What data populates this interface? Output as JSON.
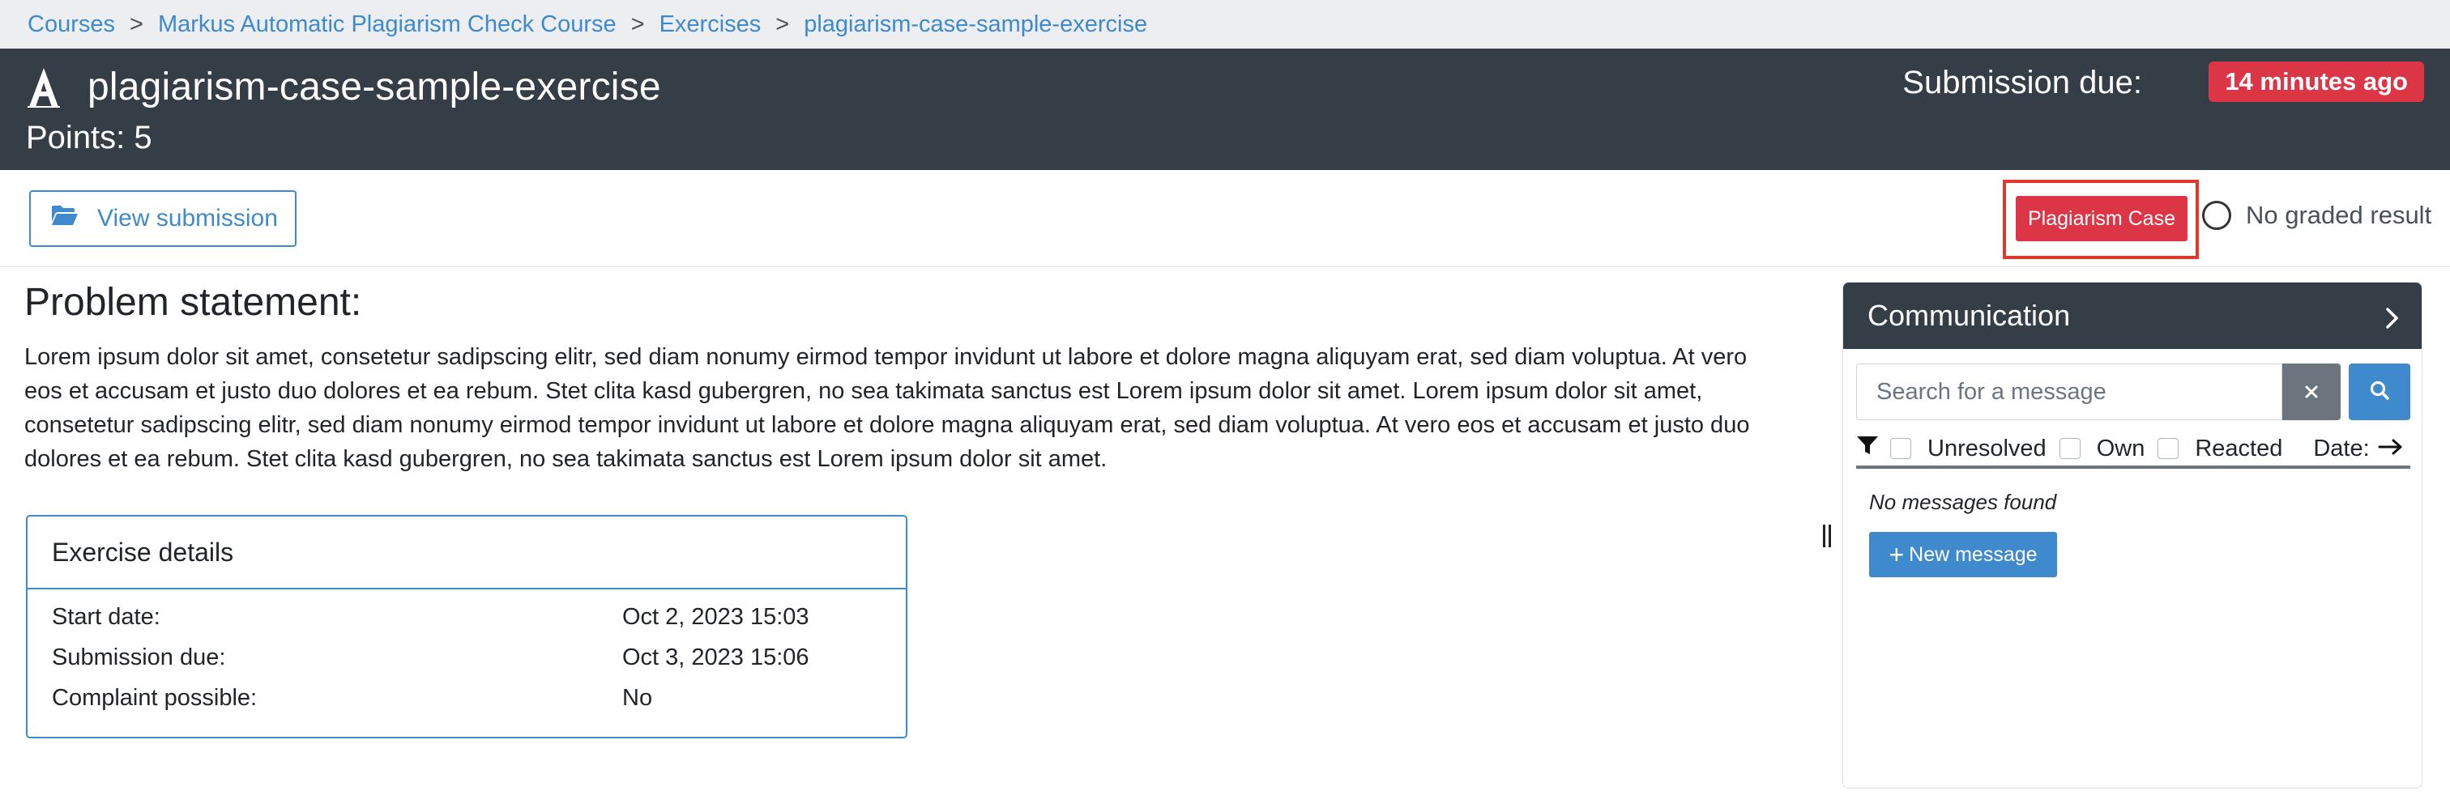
{
  "breadcrumb": {
    "items": [
      "Courses",
      "Markus Automatic Plagiarism Check Course",
      "Exercises",
      "plagiarism-case-sample-exercise"
    ],
    "separator": ">"
  },
  "header": {
    "logo_icon": "artemis-logo-icon",
    "title": "plagiarism-case-sample-exercise",
    "points": "Points: 5",
    "due_label": "Submission due:",
    "due_badge": "14 minutes ago"
  },
  "actions": {
    "view_submission": "View submission",
    "view_submission_icon": "folder-open-icon",
    "plagiarism_case": "Plagiarism Case",
    "graded_status": "No graded result"
  },
  "problem": {
    "title": "Problem statement:",
    "text": "Lorem ipsum dolor sit amet, consetetur sadipscing elitr, sed diam nonumy eirmod tempor invidunt ut labore et dolore magna aliquyam erat, sed diam voluptua. At vero eos et accusam et justo duo dolores et ea rebum. Stet clita kasd gubergren, no sea takimata sanctus est Lorem ipsum dolor sit amet. Lorem ipsum dolor sit amet, consetetur sadipscing elitr, sed diam nonumy eirmod tempor invidunt ut labore et dolore magna aliquyam erat, sed diam voluptua. At vero eos et accusam et justo duo dolores et ea rebum. Stet clita kasd gubergren, no sea takimata sanctus est Lorem ipsum dolor sit amet."
  },
  "details": {
    "title": "Exercise details",
    "rows": [
      {
        "label": "Start date:",
        "value": "Oct 2, 2023 15:03"
      },
      {
        "label": "Submission due:",
        "value": "Oct 3, 2023 15:06"
      },
      {
        "label": "Complaint possible:",
        "value": "No"
      }
    ]
  },
  "communication": {
    "title": "Communication",
    "search_placeholder": "Search for a message",
    "filters": {
      "unresolved": "Unresolved",
      "own": "Own",
      "reacted": "Reacted",
      "date": "Date:"
    },
    "empty": "No messages found",
    "new_message": "New message"
  },
  "colors": {
    "accent": "#3e8acc",
    "header_bg": "#353d47",
    "danger": "#dc3545"
  }
}
